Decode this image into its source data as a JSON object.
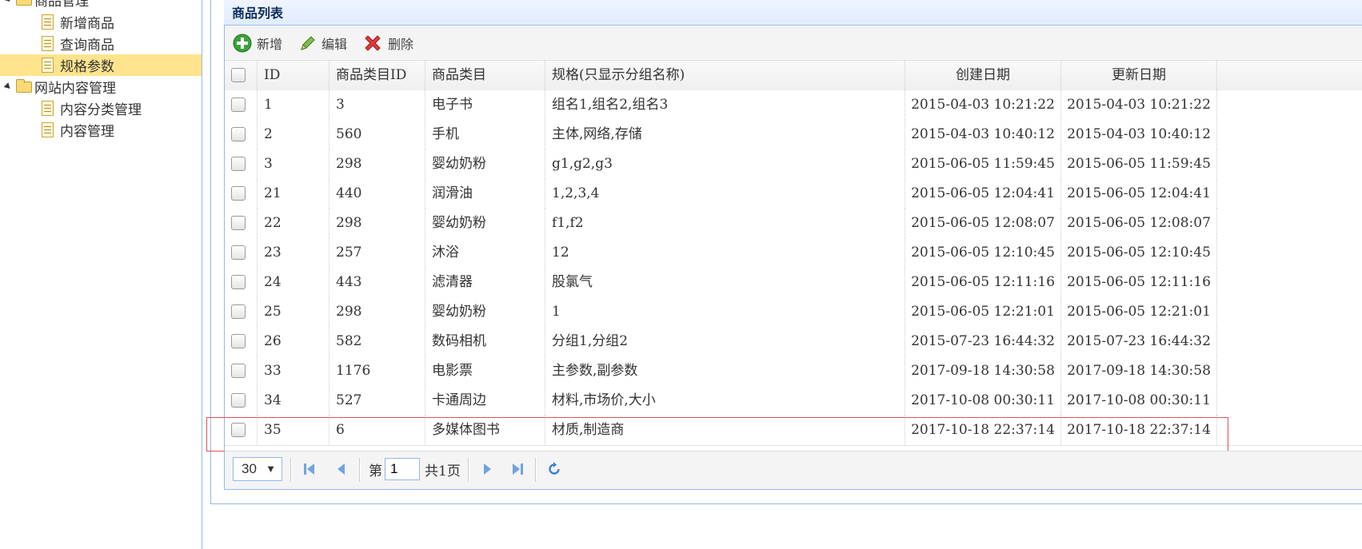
{
  "sidebar": {
    "root_partial": "商品管理",
    "items": [
      {
        "label": "新增商品"
      },
      {
        "label": "查询商品"
      },
      {
        "label": "规格参数"
      }
    ],
    "group2": "网站内容管理",
    "items2": [
      {
        "label": "内容分类管理"
      },
      {
        "label": "内容管理"
      }
    ]
  },
  "panel": {
    "title": "商品列表"
  },
  "toolbar": {
    "add": "新增",
    "edit": "编辑",
    "delete": "删除"
  },
  "grid": {
    "columns": [
      "ID",
      "商品类目ID",
      "商品类目",
      "规格(只显示分组名称)",
      "创建日期",
      "更新日期"
    ],
    "rows": [
      [
        "1",
        "3",
        "电子书",
        "组名1,组名2,组名3",
        "2015-04-03 10:21:22",
        "2015-04-03 10:21:22"
      ],
      [
        "2",
        "560",
        "手机",
        "主体,网络,存储",
        "2015-04-03 10:40:12",
        "2015-04-03 10:40:12"
      ],
      [
        "3",
        "298",
        "婴幼奶粉",
        "g1,g2,g3",
        "2015-06-05 11:59:45",
        "2015-06-05 11:59:45"
      ],
      [
        "21",
        "440",
        "润滑油",
        "1,2,3,4",
        "2015-06-05 12:04:41",
        "2015-06-05 12:04:41"
      ],
      [
        "22",
        "298",
        "婴幼奶粉",
        "f1,f2",
        "2015-06-05 12:08:07",
        "2015-06-05 12:08:07"
      ],
      [
        "23",
        "257",
        "沐浴",
        "12",
        "2015-06-05 12:10:45",
        "2015-06-05 12:10:45"
      ],
      [
        "24",
        "443",
        "滤清器",
        "股氯气",
        "2015-06-05 12:11:16",
        "2015-06-05 12:11:16"
      ],
      [
        "25",
        "298",
        "婴幼奶粉",
        "1",
        "2015-06-05 12:21:01",
        "2015-06-05 12:21:01"
      ],
      [
        "26",
        "582",
        "数码相机",
        "分组1,分组2",
        "2015-07-23 16:44:32",
        "2015-07-23 16:44:32"
      ],
      [
        "33",
        "1176",
        "电影票",
        "主参数,副参数",
        "2017-09-18 14:30:58",
        "2017-09-18 14:30:58"
      ],
      [
        "34",
        "527",
        "卡通周边",
        "材料,市场价,大小",
        "2017-10-08 00:30:11",
        "2017-10-08 00:30:11"
      ],
      [
        "35",
        "6",
        "多媒体图书",
        "材质,制造商",
        "2017-10-18 22:37:14",
        "2017-10-18 22:37:14"
      ]
    ]
  },
  "pager": {
    "page_size": "30",
    "page_prefix": "第",
    "current_page": "1",
    "total_text": "共1页"
  }
}
